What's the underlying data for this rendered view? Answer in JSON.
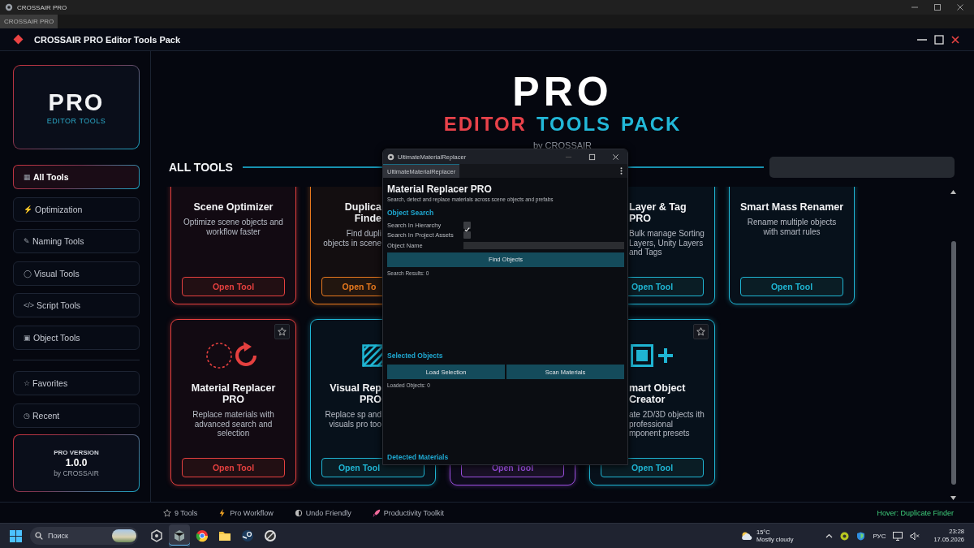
{
  "os_window": {
    "title": "CROSSAIR PRO",
    "tab": "CROSSAIR PRO"
  },
  "app_header": {
    "title": "CROSSAIR PRO Editor Tools Pack"
  },
  "sidebar": {
    "logo": {
      "title": "PRO",
      "subtitle": "EDITOR TOOLS"
    },
    "items": [
      {
        "icon": "▦",
        "label": "All Tools",
        "selected": true
      },
      {
        "icon": "⚡",
        "label": "Optimization",
        "selected": false
      },
      {
        "icon": "✎",
        "label": "Naming Tools",
        "selected": false
      },
      {
        "icon": "◯",
        "label": "Visual Tools",
        "selected": false
      },
      {
        "icon": "</>",
        "label": "Script Tools",
        "selected": false
      },
      {
        "icon": "▣",
        "label": "Object Tools",
        "selected": false
      }
    ],
    "extra_items": [
      {
        "icon": "☆",
        "label": "Favorites",
        "selected": false
      },
      {
        "icon": "◷",
        "label": "Recent",
        "selected": false
      }
    ],
    "version_card": {
      "label": "PRO VERSION",
      "version": "1.0.0",
      "author": "by CROSSAIR"
    }
  },
  "hero": {
    "title": "PRO",
    "subtitle_words": [
      {
        "text": "EDITOR",
        "color": "#e8424a"
      },
      {
        "text": "TOOLS",
        "color": "#22b8d8"
      },
      {
        "text": "PACK",
        "color": "#22b8d8"
      }
    ],
    "byline": "by CROSSAIR"
  },
  "section": {
    "title": "ALL TOOLS"
  },
  "tools": [
    {
      "color": "#e5403f",
      "kind": "whole",
      "title": "Scene Optimizer",
      "description": "Optimize scene objects and workflow faster",
      "button": "Open Tool"
    },
    {
      "color": "#e8791e",
      "kind": "cut-right",
      "title": "Duplica Finde",
      "description": "Find dupli objects in scene",
      "button": "Open To"
    },
    {
      "kind": "hidden"
    },
    {
      "color": "#1fb5d3",
      "kind": "cut-left",
      "title": "Layer & Tag PRO",
      "description": "Bulk manage Sorting Layers, Unity Layers and Tags",
      "button": "Open Tool"
    },
    {
      "color": "#1fb5d3",
      "kind": "whole",
      "title": "Smart Mass Renamer",
      "description": "Rename multiple objects with smart rules",
      "button": "Open Tool"
    },
    {
      "color": "#e5403f",
      "kind": "whole",
      "favorite": false,
      "title": "Material Replacer PRO",
      "description": "Replace materials with advanced search and selection",
      "button": "Open Tool"
    },
    {
      "color": "#1fb5d3",
      "kind": "cut-right",
      "title": "Visual Rep PRO",
      "description": "Replace sp and visuals pro too",
      "button": "Open Tool"
    },
    {
      "color": "#9b4fe0",
      "kind": "hidden",
      "button": "Open Tool"
    },
    {
      "color": "#1fb5d3",
      "kind": "cut-left",
      "favorite": false,
      "title": "mart Object Creator",
      "description": "ate 2D/3D objects ith professional mponent presets",
      "button": "Open Tool"
    }
  ],
  "dialog": {
    "title": "UltimateMaterialReplacer",
    "tab": "UltimateMaterialReplacer",
    "heading": "Material Replacer PRO",
    "description": "Search, detect and replace materials across scene objects and prefabs",
    "object_search": {
      "title": "Object Search",
      "toggles": [
        {
          "label": "Search In Hierarchy",
          "checked": true
        },
        {
          "label": "Search In Project Assets",
          "checked": false
        }
      ],
      "name_field": {
        "label": "Object Name"
      },
      "button": "Find Objects",
      "result": "Search Results: 0"
    },
    "selected_objects": {
      "title": "Selected Objects",
      "buttons": [
        "Load Selection",
        "Scan Materials"
      ],
      "result": "Loaded Objects: 0"
    },
    "detected_materials": {
      "title": "Detected Materials"
    }
  },
  "footer": {
    "items": [
      {
        "kind": "star",
        "label": "9 Tools"
      },
      {
        "kind": "bolt",
        "label": "Pro Workflow"
      },
      {
        "kind": "half",
        "label": "Undo Friendly"
      },
      {
        "kind": "rocket",
        "label": "Productivity Toolkit"
      }
    ],
    "hover": "Hover: Duplicate Finder"
  },
  "taskbar": {
    "search_placeholder": "Поиск",
    "apps": [
      {
        "kind": "hexagon",
        "selected": false
      },
      {
        "kind": "cube",
        "selected": true
      },
      {
        "kind": "browser",
        "selected": false
      },
      {
        "kind": "folder",
        "selected": false
      },
      {
        "kind": "steam",
        "selected": false
      },
      {
        "kind": "disc",
        "selected": false
      }
    ],
    "weather": {
      "temperature": "15°C",
      "condition": "Mostly cloudy"
    },
    "language": "РУС",
    "time": "23:28",
    "date": "17.05.2026"
  }
}
